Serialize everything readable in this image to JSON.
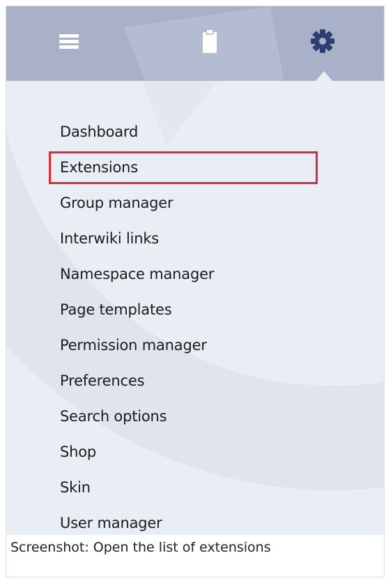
{
  "toolbar": {
    "icons": [
      "menu-icon",
      "clipboard-icon",
      "gear-icon"
    ],
    "active_tab": "gear-icon",
    "bar_color": "#a8b1c7",
    "icon_color": "#ffffff",
    "active_icon_color": "#2d3f72"
  },
  "menu": {
    "items": [
      {
        "label": "Dashboard"
      },
      {
        "label": "Extensions"
      },
      {
        "label": "Group manager"
      },
      {
        "label": "Interwiki links"
      },
      {
        "label": "Namespace manager"
      },
      {
        "label": "Page templates"
      },
      {
        "label": "Permission manager"
      },
      {
        "label": "Preferences"
      },
      {
        "label": "Search options"
      },
      {
        "label": "Shop"
      },
      {
        "label": "Skin"
      },
      {
        "label": "User manager"
      }
    ],
    "highlighted_item": "Extensions",
    "highlight_color": "#e2283b"
  },
  "caption": {
    "text": "Screenshot: Open the list of extensions"
  }
}
